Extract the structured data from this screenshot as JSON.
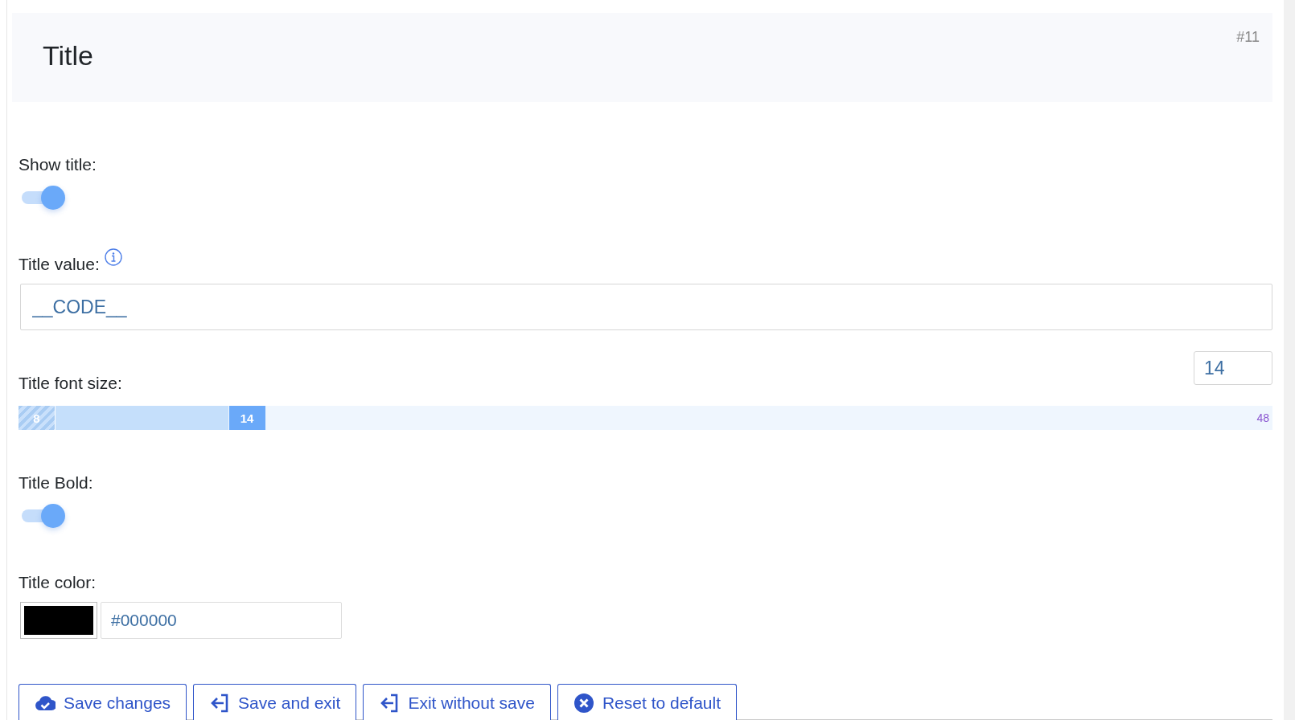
{
  "header": {
    "title": "Title",
    "badge": "#11"
  },
  "fields": [
    {
      "kind": "toggle",
      "label": "Show title:",
      "on": true
    },
    {
      "kind": "text",
      "label": "Title value:",
      "info": true,
      "value": "__CODE__"
    },
    {
      "kind": "slider",
      "label": "Title font size:",
      "value": "14",
      "handle_label": "14",
      "min": "8",
      "max": "48",
      "level": 0.15
    },
    {
      "kind": "toggle",
      "label": "Title Bold:",
      "on": true
    },
    {
      "kind": "color",
      "label": "Title color:",
      "color": "#000000",
      "value": "#000000"
    }
  ],
  "buttons": [
    {
      "kind": "save",
      "label": "Save changes"
    },
    {
      "kind": "exit",
      "label": "Save and exit"
    },
    {
      "kind": "exit",
      "label": "Exit without save"
    },
    {
      "kind": "reset",
      "label": "Reset to default"
    }
  ]
}
